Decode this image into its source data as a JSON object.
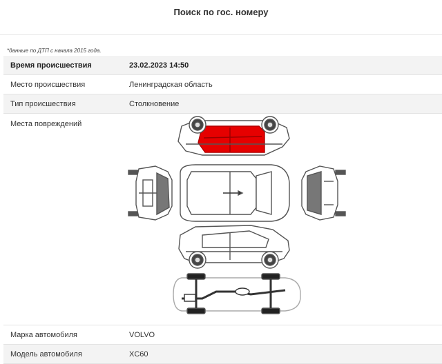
{
  "header": {
    "title": "Поиск по гос. номеру"
  },
  "note": "*данные по ДТП с начала 2015 года.",
  "rows": [
    {
      "label": "Время происшествия",
      "value": "23.02.2023 14:50"
    },
    {
      "label": "Место происшествия",
      "value": "Ленинградская область"
    },
    {
      "label": "Тип происшествия",
      "value": "Столкновение"
    },
    {
      "label": "Места повреждений",
      "value": ""
    },
    {
      "label": "Марка автомобиля",
      "value": "VOLVO"
    },
    {
      "label": "Модель автомобиля",
      "value": "XC60"
    }
  ],
  "damage": {
    "zone": "left-side-doors",
    "color": "#e60000"
  },
  "colors": {
    "row_alt": "#f3f3f3",
    "border": "#e3e3e3",
    "car_outline": "#555555"
  }
}
